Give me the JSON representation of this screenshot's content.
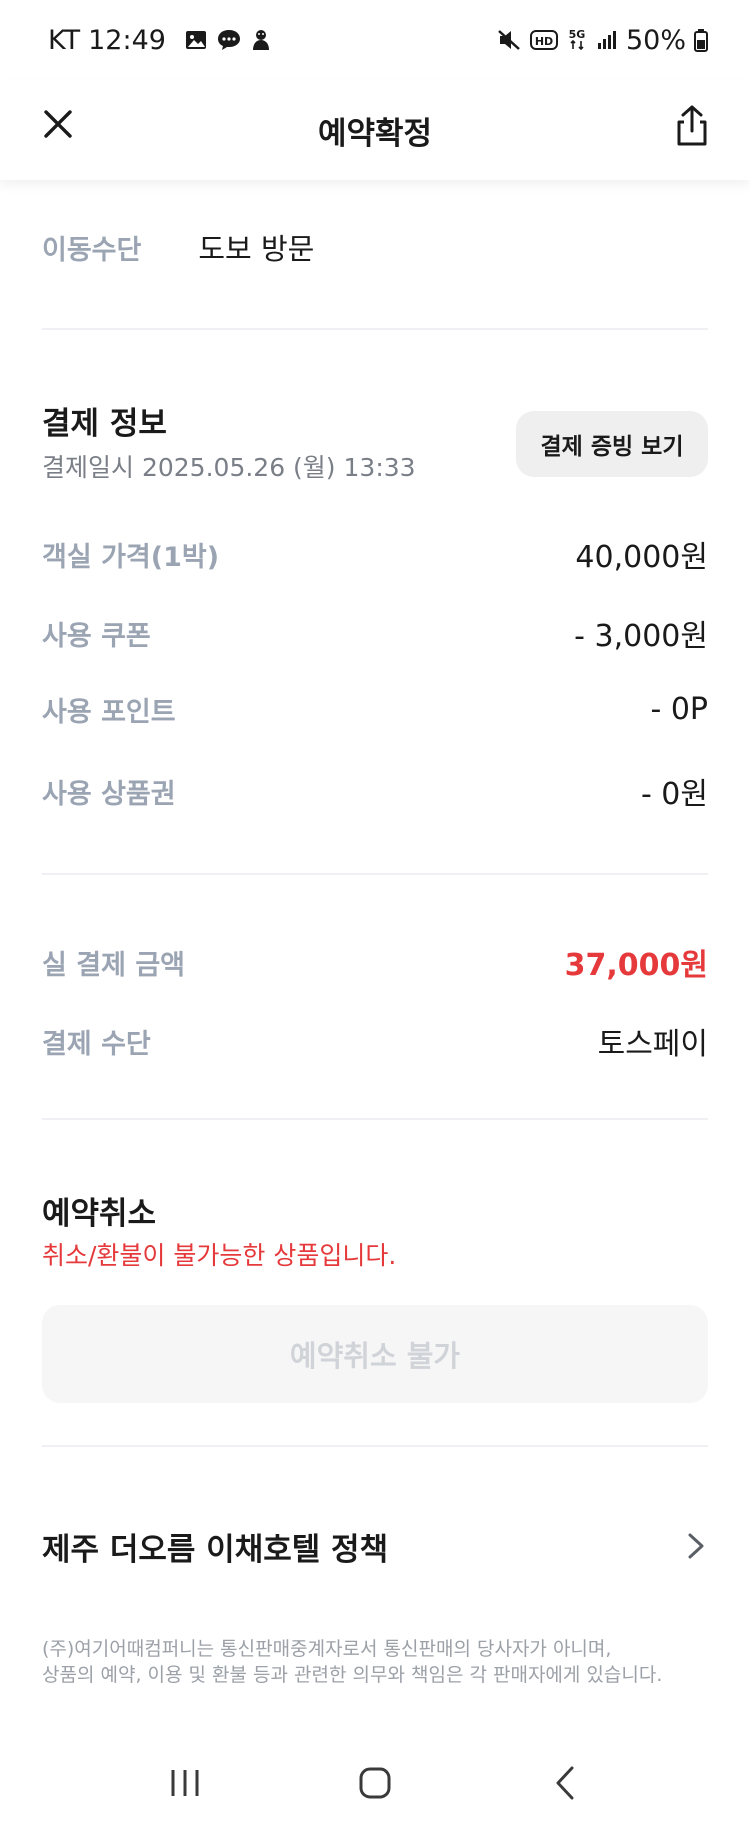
{
  "status_bar": {
    "carrier": "KT",
    "time": "12:49",
    "battery": "50%",
    "left_icons": [
      "gallery-icon",
      "chat-icon",
      "character-icon"
    ],
    "right_icons": [
      "mute-icon",
      "hd-icon",
      "5g-icon",
      "signal-icon",
      "battery-icon"
    ]
  },
  "header": {
    "title": "예약확정",
    "close_icon": "close-icon",
    "share_icon": "share-icon"
  },
  "transport": {
    "label": "이동수단",
    "value": "도보 방문"
  },
  "payment": {
    "title": "결제 정보",
    "datetime_label": "결제일시",
    "datetime": "2025.05.26 (월) 13:33",
    "proof_button": "결제 증빙 보기",
    "items": [
      {
        "label": "객실 가격(1박)",
        "value": "40,000원"
      },
      {
        "label": "사용 쿠폰",
        "value": "- 3,000원"
      },
      {
        "label": "사용 포인트",
        "value": "- 0P"
      },
      {
        "label": "사용 상품권",
        "value": "- 0원"
      }
    ],
    "total_label": "실 결제 금액",
    "total_value": "37,000원",
    "method_label": "결제 수단",
    "method_value": "토스페이"
  },
  "cancel": {
    "title": "예약취소",
    "notice": "취소/환불이 불가능한 상품입니다.",
    "button": "예약취소 불가"
  },
  "policy": {
    "title": "제주 더오름 이채호텔 정책",
    "chevron_icon": "chevron-right-icon"
  },
  "footnote": {
    "line1": "(주)여기어때컴퍼니는 통신판매중계자로서 통신판매의 당사자가 아니며,",
    "line2": "상품의 예약, 이용 및 환불 등과 관련한 의무와 책임은 각 판매자에게 있습니다."
  },
  "nav": {
    "icons": [
      "recent-apps-icon",
      "home-icon",
      "back-icon"
    ]
  },
  "colors": {
    "accent_red": "#e5393b",
    "label_gray": "#9aa4b2"
  }
}
